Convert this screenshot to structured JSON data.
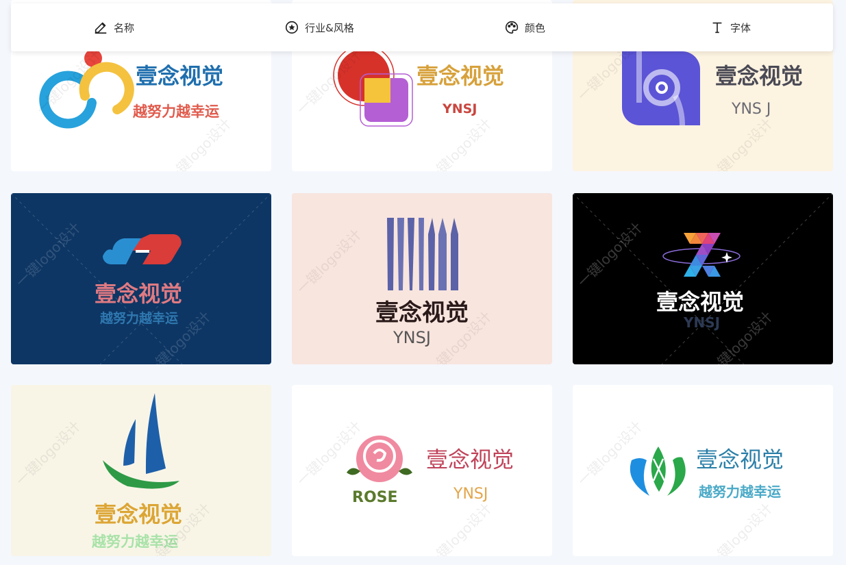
{
  "toolbar": {
    "items": [
      {
        "label": "名称",
        "icon": "pencil-icon"
      },
      {
        "label": "行业&风格",
        "icon": "star-circle-icon"
      },
      {
        "label": "颜色",
        "icon": "palette-icon"
      },
      {
        "label": "字体",
        "icon": "font-icon"
      }
    ]
  },
  "watermark": "一键logo设计",
  "cards": [
    {
      "name": "壹念视觉",
      "slogan": "越努力越幸运",
      "bg": "#ffffff"
    },
    {
      "name": "壹念视觉",
      "slogan": "YNSJ",
      "bg": "#ffffff"
    },
    {
      "name": "壹念视觉",
      "slogan": "YNS J",
      "bg": "#fdf3e1"
    },
    {
      "name": "壹念视觉",
      "slogan": "越努力越幸运",
      "bg": "#0d3664"
    },
    {
      "name": "壹念视觉",
      "slogan": "YNSJ",
      "bg": "#f8e5de"
    },
    {
      "name": "壹念视觉",
      "slogan": "YNSJ",
      "bg": "#000000"
    },
    {
      "name": "壹念视觉",
      "slogan": "越努力越幸运",
      "bg": "#f8f5e7"
    },
    {
      "name": "壹念视觉",
      "slogan": "YNSJ",
      "badge": "ROSE",
      "bg": "#ffffff"
    },
    {
      "name": "壹念视觉",
      "slogan": "越努力越幸运",
      "bg": "#ffffff"
    }
  ]
}
